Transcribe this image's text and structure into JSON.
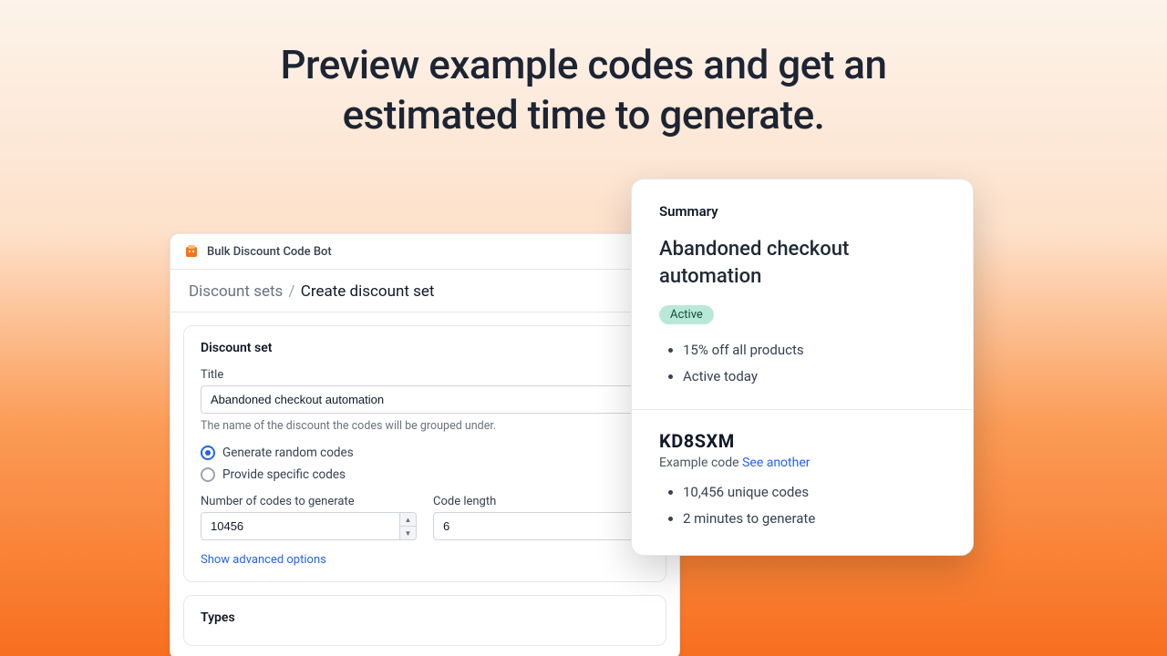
{
  "hero": {
    "line1": "Preview example codes and get an",
    "line2": "estimated time to generate."
  },
  "app": {
    "name": "Bulk Discount Code Bot"
  },
  "breadcrumb": {
    "parent": "Discount sets",
    "current": "Create discount set"
  },
  "form": {
    "section_title": "Discount set",
    "title_label": "Title",
    "title_value": "Abandoned checkout automation",
    "title_help": "The name of the discount the codes will be grouped under.",
    "radio_random": "Generate random codes",
    "radio_specific": "Provide specific codes",
    "num_label": "Number of codes to generate",
    "num_value": "10456",
    "length_label": "Code length",
    "length_value": "6",
    "advanced_link": "Show advanced options",
    "types_title": "Types"
  },
  "summary": {
    "heading": "Summary",
    "title": "Abandoned checkout automation",
    "badge": "Active",
    "items": [
      "15% off all products",
      "Active today"
    ],
    "example_code": "KD8SXM",
    "example_label": "Example code",
    "see_another": "See another",
    "stats": [
      "10,456 unique codes",
      "2 minutes to generate"
    ]
  }
}
